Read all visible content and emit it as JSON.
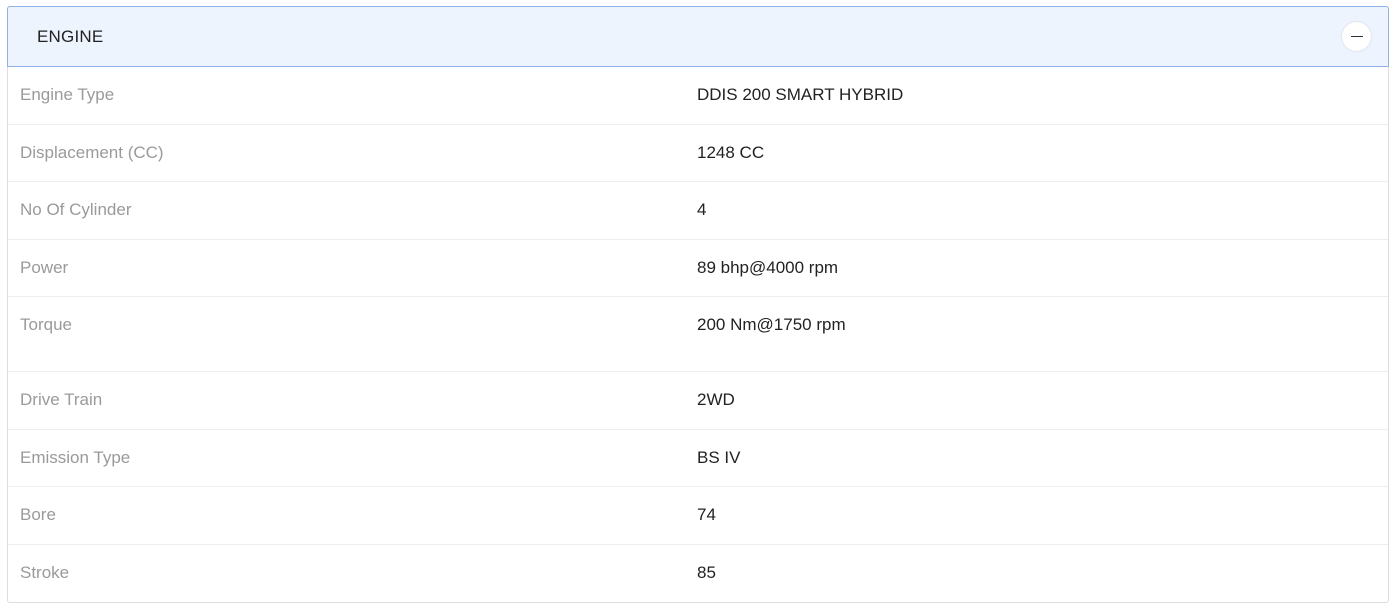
{
  "section": {
    "title": "ENGINE",
    "collapse_icon": "minus-icon"
  },
  "specs": [
    {
      "label": "Engine Type",
      "value": "DDIS 200 SMART HYBRID"
    },
    {
      "label": "Displacement (CC)",
      "value": "1248 CC"
    },
    {
      "label": "No Of Cylinder",
      "value": "4"
    },
    {
      "label": "Power",
      "value": "89 bhp@4000 rpm"
    },
    {
      "label": "Torque",
      "value": "200 Nm@1750 rpm"
    },
    {
      "label": "Drive Train",
      "value": "2WD"
    },
    {
      "label": "Emission Type",
      "value": "BS IV"
    },
    {
      "label": "Bore",
      "value": "74"
    },
    {
      "label": "Stroke",
      "value": "85"
    }
  ]
}
